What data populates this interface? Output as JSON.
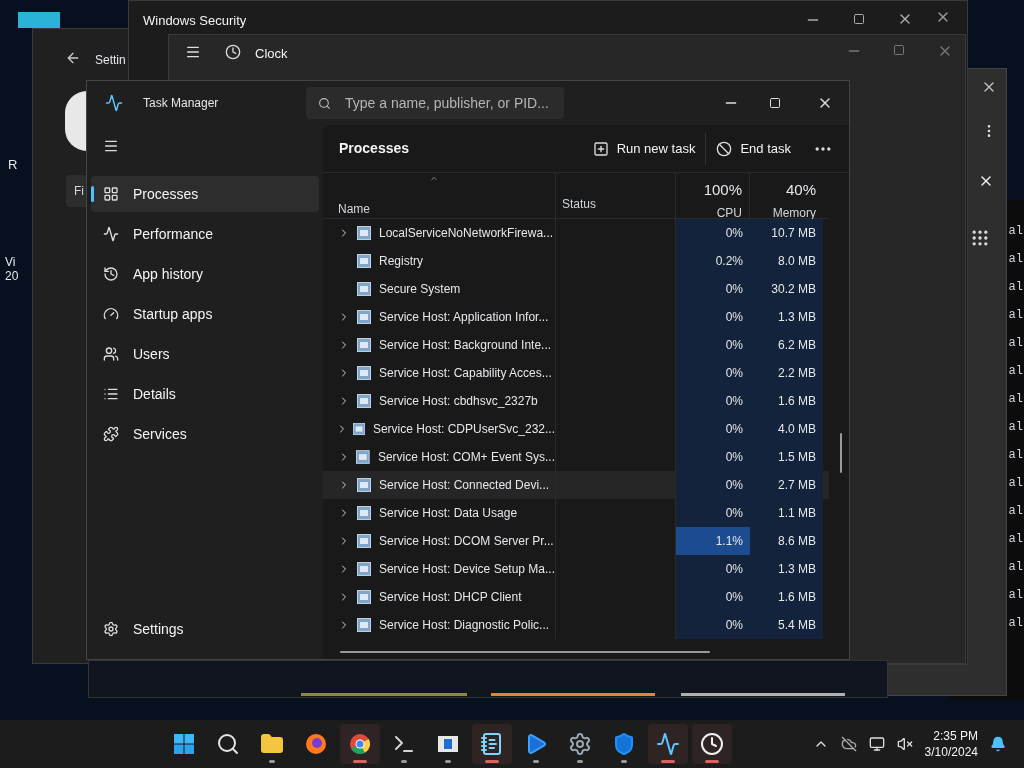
{
  "desktop": {
    "icon_labels": [
      "R",
      "Vi",
      "20"
    ]
  },
  "security_window": {
    "title": "Windows Security"
  },
  "clock_window": {
    "title": "Clock"
  },
  "settings_window": {
    "title": "Settin",
    "field_fragment": "Fi"
  },
  "terminal": {
    "lines": [
      "al",
      "al",
      "al",
      "al",
      "al",
      "al",
      "al",
      "al",
      "al",
      "al",
      "al",
      "al",
      "al",
      "al",
      "al"
    ]
  },
  "task_manager": {
    "title": "Task Manager",
    "search_placeholder": "Type a name, publisher, or PID...",
    "nav": [
      {
        "label": "Processes",
        "selected": true
      },
      {
        "label": "Performance",
        "selected": false
      },
      {
        "label": "App history",
        "selected": false
      },
      {
        "label": "Startup apps",
        "selected": false
      },
      {
        "label": "Users",
        "selected": false
      },
      {
        "label": "Details",
        "selected": false
      },
      {
        "label": "Services",
        "selected": false
      }
    ],
    "settings_label": "Settings",
    "page_title": "Processes",
    "actions": [
      {
        "label": "Run new task"
      },
      {
        "label": "End task"
      }
    ],
    "columns": {
      "name": "Name",
      "status": "Status",
      "cpu_total": "100%",
      "cpu": "CPU",
      "memory_total": "40%",
      "memory": "Memory"
    },
    "rows": [
      {
        "name": "LocalServiceNoNetworkFirewa...",
        "expandable": true,
        "hovered": false,
        "cpu": "0%",
        "cpu_high": false,
        "memory": "10.7 MB"
      },
      {
        "name": "Registry",
        "expandable": false,
        "hovered": false,
        "cpu": "0.2%",
        "cpu_high": false,
        "memory": "8.0 MB"
      },
      {
        "name": "Secure System",
        "expandable": false,
        "hovered": false,
        "cpu": "0%",
        "cpu_high": false,
        "memory": "30.2 MB"
      },
      {
        "name": "Service Host: Application Infor...",
        "expandable": true,
        "hovered": false,
        "cpu": "0%",
        "cpu_high": false,
        "memory": "1.3 MB"
      },
      {
        "name": "Service Host: Background Inte...",
        "expandable": true,
        "hovered": false,
        "cpu": "0%",
        "cpu_high": false,
        "memory": "6.2 MB"
      },
      {
        "name": "Service Host: Capability Acces...",
        "expandable": true,
        "hovered": false,
        "cpu": "0%",
        "cpu_high": false,
        "memory": "2.2 MB"
      },
      {
        "name": "Service Host: cbdhsvc_2327b",
        "expandable": true,
        "hovered": false,
        "cpu": "0%",
        "cpu_high": false,
        "memory": "1.6 MB"
      },
      {
        "name": "Service Host: CDPUserSvc_232...",
        "expandable": true,
        "hovered": false,
        "cpu": "0%",
        "cpu_high": false,
        "memory": "4.0 MB"
      },
      {
        "name": "Service Host: COM+ Event Sys...",
        "expandable": true,
        "hovered": false,
        "cpu": "0%",
        "cpu_high": false,
        "memory": "1.5 MB"
      },
      {
        "name": "Service Host: Connected Devi...",
        "expandable": true,
        "hovered": true,
        "cpu": "0%",
        "cpu_high": false,
        "memory": "2.7 MB"
      },
      {
        "name": "Service Host: Data Usage",
        "expandable": true,
        "hovered": false,
        "cpu": "0%",
        "cpu_high": false,
        "memory": "1.1 MB"
      },
      {
        "name": "Service Host: DCOM Server Pr...",
        "expandable": true,
        "hovered": false,
        "cpu": "1.1%",
        "cpu_high": true,
        "memory": "8.6 MB"
      },
      {
        "name": "Service Host: Device Setup Ma...",
        "expandable": true,
        "hovered": false,
        "cpu": "0%",
        "cpu_high": false,
        "memory": "1.3 MB"
      },
      {
        "name": "Service Host: DHCP Client",
        "expandable": true,
        "hovered": false,
        "cpu": "0%",
        "cpu_high": false,
        "memory": "1.6 MB"
      },
      {
        "name": "Service Host: Diagnostic Polic...",
        "expandable": true,
        "hovered": false,
        "cpu": "0%",
        "cpu_high": false,
        "memory": "5.4 MB"
      }
    ]
  },
  "taskbar": {
    "apps": [
      {
        "kind": "start",
        "running": false,
        "active": false
      },
      {
        "kind": "search",
        "running": false,
        "active": false
      },
      {
        "kind": "explorer",
        "running": true,
        "active": false
      },
      {
        "kind": "firefox",
        "running": false,
        "active": false
      },
      {
        "kind": "chrome",
        "running": true,
        "active": true
      },
      {
        "kind": "terminal",
        "running": true,
        "active": false
      },
      {
        "kind": "screen",
        "running": true,
        "active": false
      },
      {
        "kind": "notepad",
        "running": true,
        "active": true
      },
      {
        "kind": "video",
        "running": true,
        "active": false
      },
      {
        "kind": "settings",
        "running": true,
        "active": false
      },
      {
        "kind": "security",
        "running": true,
        "active": false
      },
      {
        "kind": "taskmanager",
        "running": true,
        "active": true
      },
      {
        "kind": "clock",
        "running": true,
        "active": true
      }
    ],
    "time": "2:35 PM",
    "date": "3/10/2024"
  }
}
